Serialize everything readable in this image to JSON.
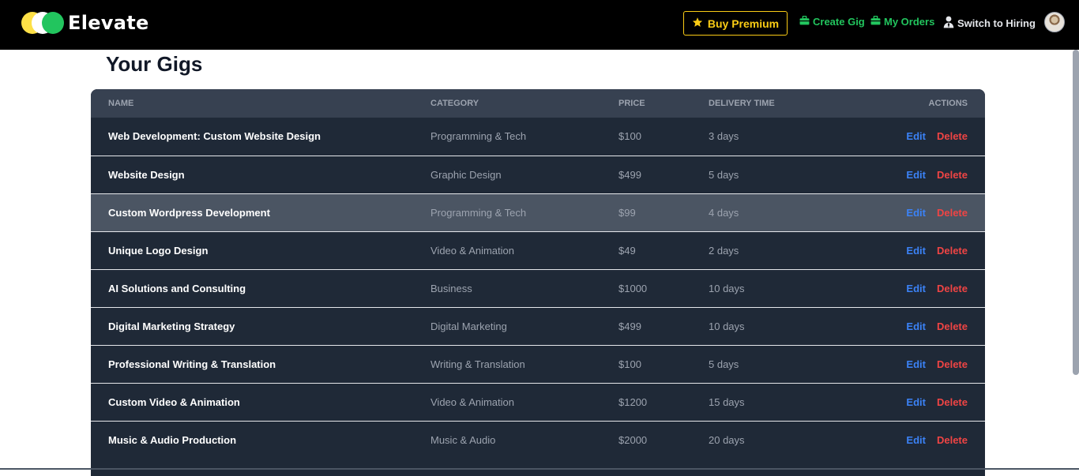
{
  "brand": {
    "name": "Elevate",
    "colors": {
      "circle1": "#fde047",
      "circle2": "#ffffff",
      "circle3": "#22c55e"
    }
  },
  "nav": {
    "premium_label": "Buy Premium",
    "create_gig_label": "Create Gig",
    "my_orders_label": "My Orders",
    "switch_label": "Switch to Hiring",
    "accent_yellow": "#facc15",
    "accent_green": "#22c55e"
  },
  "page": {
    "title": "Your Gigs"
  },
  "table": {
    "headers": {
      "name": "NAME",
      "category": "CATEGORY",
      "price": "PRICE",
      "delivery": "DELIVERY TIME",
      "actions": "ACTIONS"
    },
    "edit_label": "Edit",
    "delete_label": "Delete",
    "rows": [
      {
        "name": "Web Development: Custom Website Design",
        "category": "Programming & Tech",
        "price": "$100",
        "delivery": "3 days"
      },
      {
        "name": "Website Design",
        "category": "Graphic Design",
        "price": "$499",
        "delivery": "5 days"
      },
      {
        "name": "Custom Wordpress Development",
        "category": "Programming & Tech",
        "price": "$99",
        "delivery": "4 days",
        "hovered": true
      },
      {
        "name": "Unique Logo Design",
        "category": "Video & Animation",
        "price": "$49",
        "delivery": "2 days"
      },
      {
        "name": "AI Solutions and Consulting",
        "category": "Business",
        "price": "$1000",
        "delivery": "10 days"
      },
      {
        "name": "Digital Marketing Strategy",
        "category": "Digital Marketing",
        "price": "$499",
        "delivery": "10 days"
      },
      {
        "name": "Professional Writing & Translation",
        "category": "Writing & Translation",
        "price": "$100",
        "delivery": "5 days"
      },
      {
        "name": "Custom Video & Animation",
        "category": "Video & Animation",
        "price": "$1200",
        "delivery": "15 days"
      },
      {
        "name": "Music & Audio Production",
        "category": "Music & Audio",
        "price": "$2000",
        "delivery": "20 days"
      }
    ]
  }
}
